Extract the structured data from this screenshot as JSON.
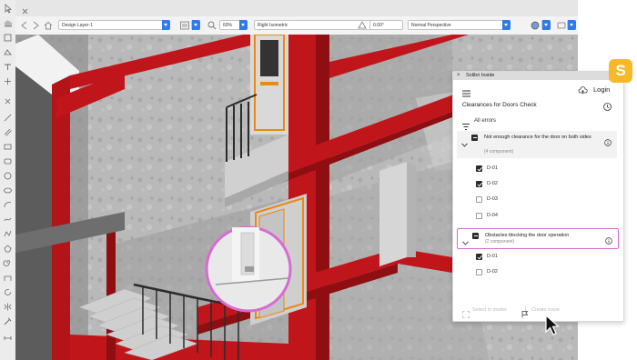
{
  "viewbar": {
    "layer": "Design Layer-1",
    "zoom": "60%",
    "view": "Right Isometric",
    "angle": "0.00°",
    "projection": "Normal Perspective"
  },
  "panel": {
    "title": "Solibri Inside",
    "login_label": "Login",
    "section_title": "Clearances for Doors Check",
    "filter_label": "All errors",
    "groups": [
      {
        "title": "Not enough clearance for the door on both sides",
        "subtitle": "(4 component)",
        "items": [
          {
            "label": "D-01",
            "checked": true
          },
          {
            "label": "D-02",
            "checked": true
          },
          {
            "label": "D-03",
            "checked": false
          },
          {
            "label": "D-04",
            "checked": false
          }
        ]
      },
      {
        "title": "Obstacles blocking the door operation",
        "subtitle": "(2 component)",
        "items": [
          {
            "label": "D-01",
            "checked": true
          },
          {
            "label": "D-02",
            "checked": false
          }
        ]
      }
    ],
    "footer": {
      "select_label": "Select in model",
      "issue_label": "Create issue"
    }
  },
  "logo": {
    "letter": "S",
    "color": "#f7b928"
  },
  "colors": {
    "structure_red": "#c0161b",
    "door_orange": "#e98a16",
    "highlight_pink": "#d86bd3",
    "accent_blue": "#2f7be8"
  }
}
